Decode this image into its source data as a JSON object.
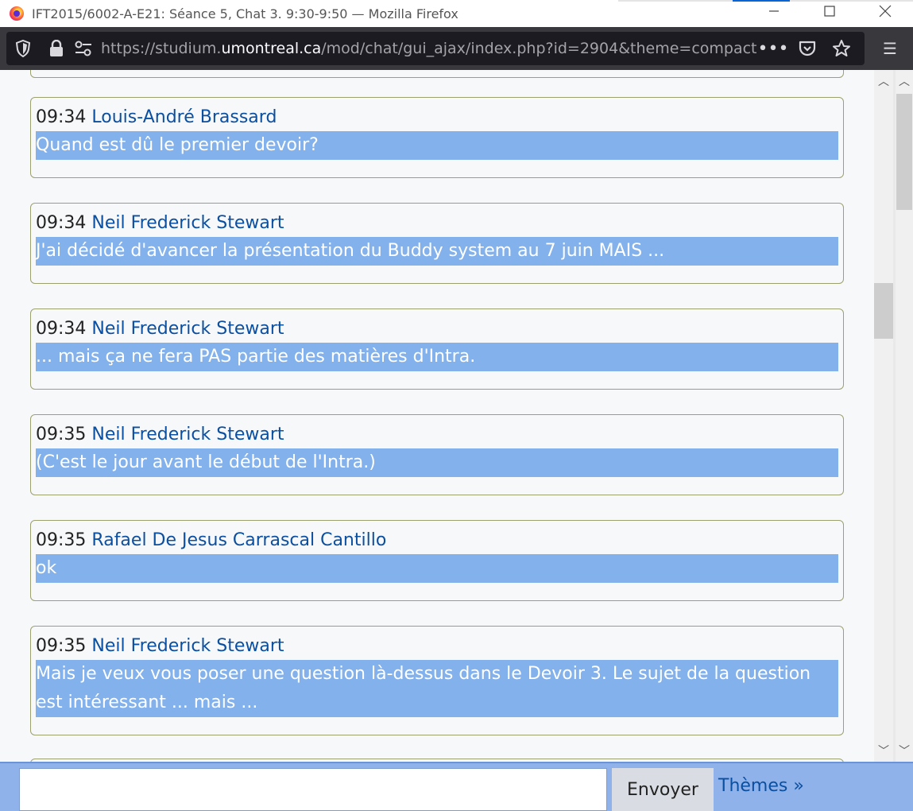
{
  "window": {
    "title": "IFT2015/6002-A-E21: Séance 5, Chat 3. 9:30-9:50 — Mozilla Firefox",
    "minimize_icon": "minimize-icon",
    "maximize_icon": "maximize-icon",
    "close_icon": "close-icon"
  },
  "toolbar": {
    "url_prefix": "https://studium.",
    "url_host": "umontreal.ca",
    "url_path": "/mod/chat/gui_ajax/index.php?id=2904&theme=compact",
    "dots": "•••",
    "hamburger": "☰"
  },
  "messages": [
    {
      "time": "09:34",
      "user": "Louis-André Brassard",
      "text": "Quand est dû le premier devoir?"
    },
    {
      "time": "09:34",
      "user": "Neil Frederick Stewart",
      "text": "J'ai décidé d'avancer la présentation du Buddy system au 7 juin MAIS ..."
    },
    {
      "time": "09:34",
      "user": "Neil Frederick Stewart",
      "text": "... mais ça ne fera PAS partie des matières d'Intra."
    },
    {
      "time": "09:35",
      "user": "Neil Frederick Stewart",
      "text": "(C'est le jour avant le début de l'Intra.)"
    },
    {
      "time": "09:35",
      "user": "Rafael De Jesus Carrascal Cantillo",
      "text": "ok"
    },
    {
      "time": "09:35",
      "user": "Neil Frederick Stewart",
      "text": "Mais je veux vous poser une question là-dessus dans le Devoir 3. Le sujet de la question est intéressant ... mais ..."
    }
  ],
  "input": {
    "value": "",
    "send_label": "Envoyer",
    "themes_label": "Thèmes »"
  }
}
